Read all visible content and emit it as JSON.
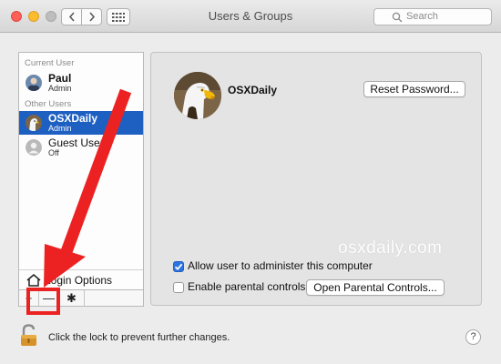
{
  "window": {
    "title": "Users & Groups",
    "search_placeholder": "Search"
  },
  "sidebar": {
    "current_user_header": "Current User",
    "other_users_header": "Other Users",
    "users": [
      {
        "name": "Paul",
        "role": "Admin",
        "section": "current"
      },
      {
        "name": "OSXDaily",
        "role": "Admin",
        "section": "other",
        "selected": true
      },
      {
        "name": "Guest User",
        "role": "Off",
        "section": "other"
      }
    ],
    "login_options_label": "Login Options",
    "add_symbol": "+",
    "remove_symbol": "—",
    "gear_symbol": "✱"
  },
  "detail": {
    "user_name": "OSXDaily",
    "reset_password_label": "Reset Password...",
    "allow_admin_label": "Allow user to administer this computer",
    "allow_admin_checked": true,
    "enable_parental_label": "Enable parental controls",
    "enable_parental_checked": false,
    "open_parental_label": "Open Parental Controls...",
    "watermark": "osxdaily.com"
  },
  "footer": {
    "lock_text": "Click the lock to prevent further changes.",
    "help_symbol": "?"
  },
  "icons": {
    "back": "chevron-left-icon",
    "forward": "chevron-right-icon",
    "grid": "grid-icon",
    "search": "magnifier-icon",
    "lock": "unlocked-padlock-icon",
    "home": "house-icon"
  },
  "colors": {
    "selection": "#1e5fc2",
    "annotation": "#ec2222",
    "checkbox_checked": "#2d73e0"
  }
}
